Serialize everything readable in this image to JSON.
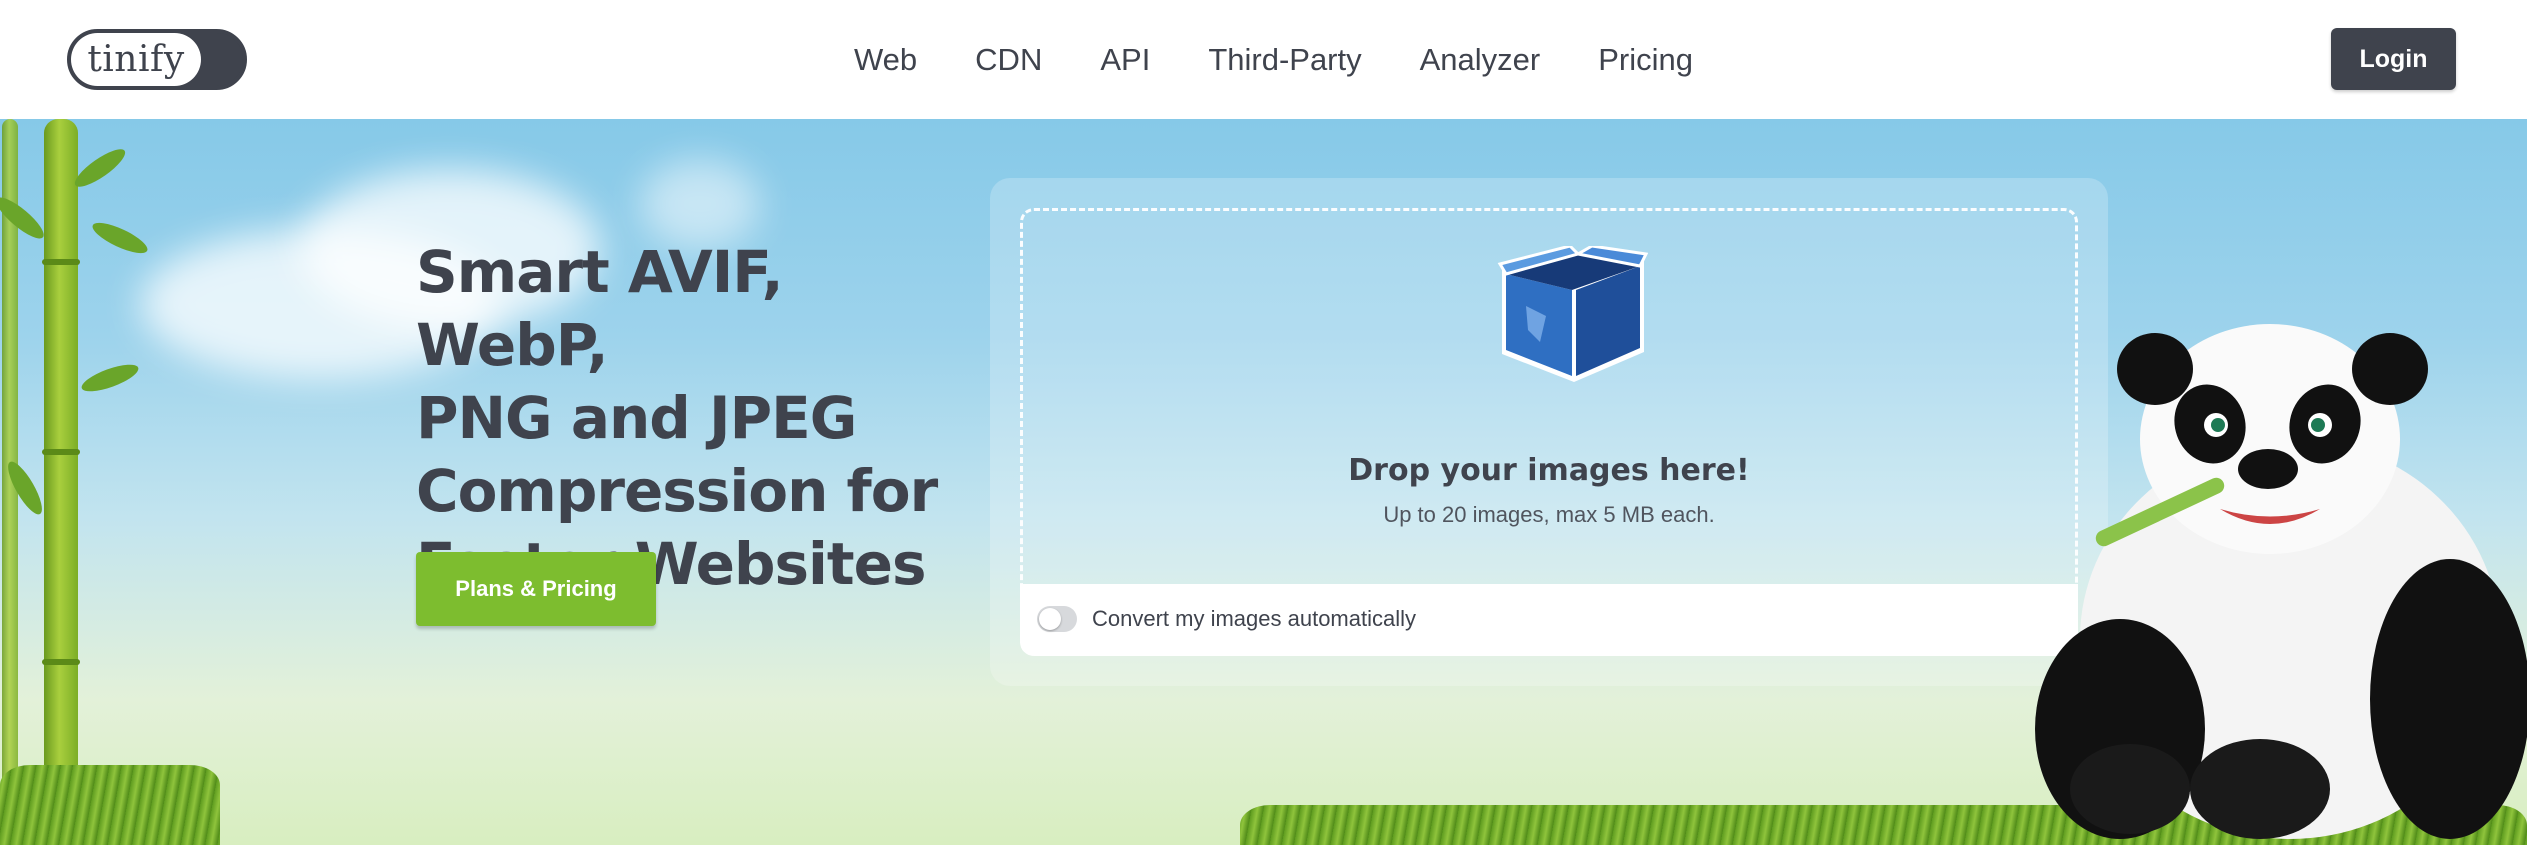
{
  "header": {
    "logo_text": "tinify",
    "nav": [
      "Web",
      "CDN",
      "API",
      "Third-Party",
      "Analyzer",
      "Pricing"
    ],
    "login_label": "Login"
  },
  "hero": {
    "headline_lines": [
      "Smart AVIF, WebP,",
      "PNG and JPEG",
      "Compression for",
      "Faster Websites"
    ],
    "cta_label": "Plans & Pricing"
  },
  "dropzone": {
    "title": "Drop your images here!",
    "subtitle": "Up to 20 images, max 5 MB each.",
    "icon": "open-box-icon",
    "convert_label": "Convert my images automatically",
    "convert_enabled": false
  },
  "colors": {
    "text_dark": "#3f434d",
    "cta_green": "#7dbd2f",
    "sky_top": "#86c9e8"
  }
}
